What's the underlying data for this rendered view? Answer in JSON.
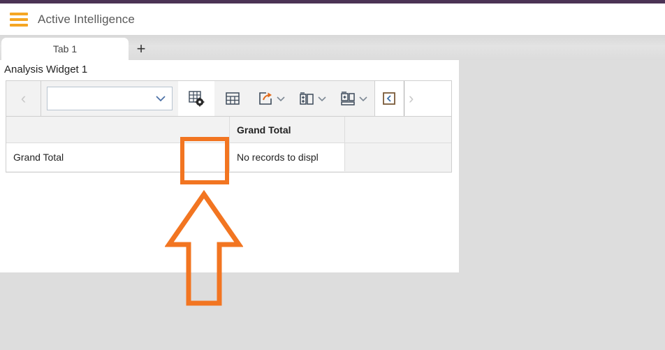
{
  "theme": {
    "top_rule_color": "#4b3355",
    "accent_orange": "#f5a623",
    "annotation_orange": "#f27521",
    "canvas_bg": "#dddddd",
    "panel_bg": "#ffffff",
    "toolbar_bg": "#f2f2f2"
  },
  "header": {
    "menu_icon": "hamburger-icon",
    "title": "Active Intelligence"
  },
  "tabs": {
    "items": [
      {
        "label": "Tab 1",
        "selected": true
      }
    ],
    "add_label": "+",
    "add_icon": "plus-icon"
  },
  "widget": {
    "title": "Analysis Widget 1"
  },
  "toolbar": {
    "prev_icon": "chevron-left-icon",
    "prev_label": "‹",
    "next_icon": "chevron-right-icon",
    "next_label": "›",
    "dimension_select": {
      "value": "",
      "placeholder": "",
      "chevron_icon": "chevron-down-icon"
    },
    "buttons": [
      {
        "name": "properties-button",
        "icon": "table-settings-icon",
        "label": "",
        "active": true,
        "has_dropdown": false
      },
      {
        "name": "table-view-button",
        "icon": "table-grid-icon",
        "label": "",
        "active": false,
        "has_dropdown": false
      },
      {
        "name": "export-button",
        "icon": "share-export-icon",
        "label": "",
        "active": false,
        "has_dropdown": true
      },
      {
        "name": "insert-column-button",
        "icon": "insert-column-icon",
        "label": "",
        "active": false,
        "has_dropdown": true
      },
      {
        "name": "insert-row-button",
        "icon": "insert-row-icon",
        "label": "",
        "active": false,
        "has_dropdown": true
      },
      {
        "name": "collapse-button",
        "icon": "collapse-panel-icon",
        "label": "",
        "active": false,
        "has_dropdown": false
      }
    ]
  },
  "pivot_table": {
    "header_row": [
      "",
      "Grand Total",
      ""
    ],
    "body_rows": [
      [
        "Grand Total",
        "No records to displ",
        ""
      ]
    ]
  },
  "annotations": {
    "highlight_target": "properties-button",
    "arrow_direction": "up",
    "color": "#f27521"
  }
}
